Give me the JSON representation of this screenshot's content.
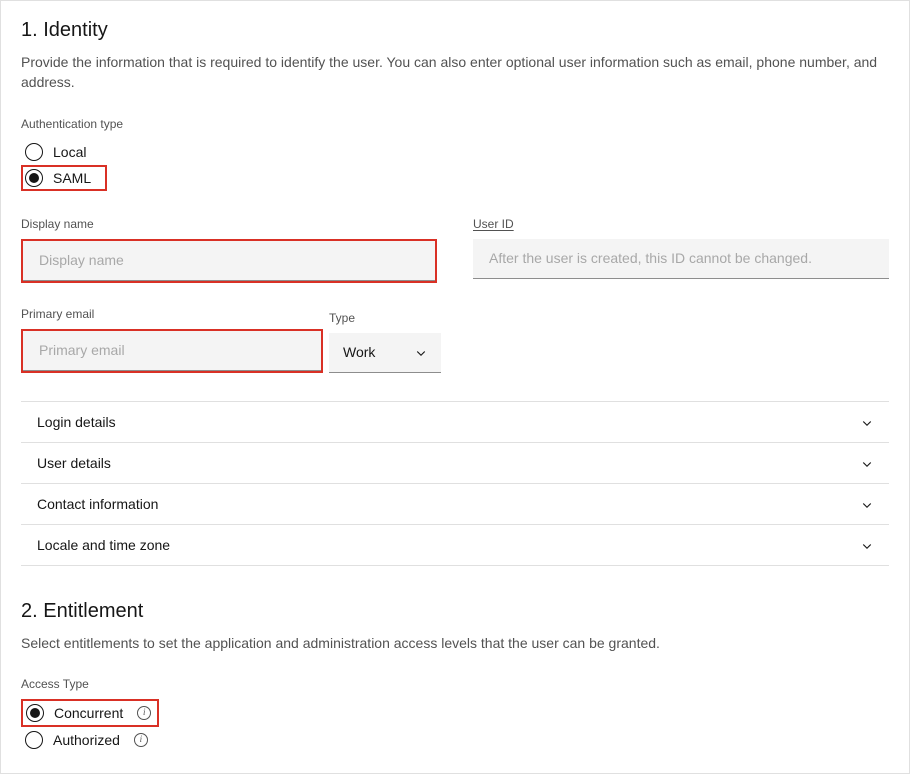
{
  "identity": {
    "title": "1. Identity",
    "description": "Provide the information that is required to identify the user. You can also enter optional user information such as email, phone number, and address.",
    "auth_type_label": "Authentication type",
    "auth_options": {
      "local": "Local",
      "saml": "SAML"
    },
    "display_name_label": "Display name",
    "display_name_placeholder": "Display name",
    "user_id_label": "User ID",
    "user_id_placeholder": "After the user is created, this ID cannot be changed.",
    "primary_email_label": "Primary email",
    "primary_email_placeholder": "Primary email",
    "email_type_label": "Type",
    "email_type_value": "Work",
    "accordion": [
      "Login details",
      "User details",
      "Contact information",
      "Locale and time zone"
    ]
  },
  "entitlement": {
    "title": "2. Entitlement",
    "description": "Select entitlements to set the application and administration access levels that the user can be granted.",
    "access_type_label": "Access Type",
    "access_options": {
      "concurrent": "Concurrent",
      "authorized": "Authorized"
    }
  }
}
